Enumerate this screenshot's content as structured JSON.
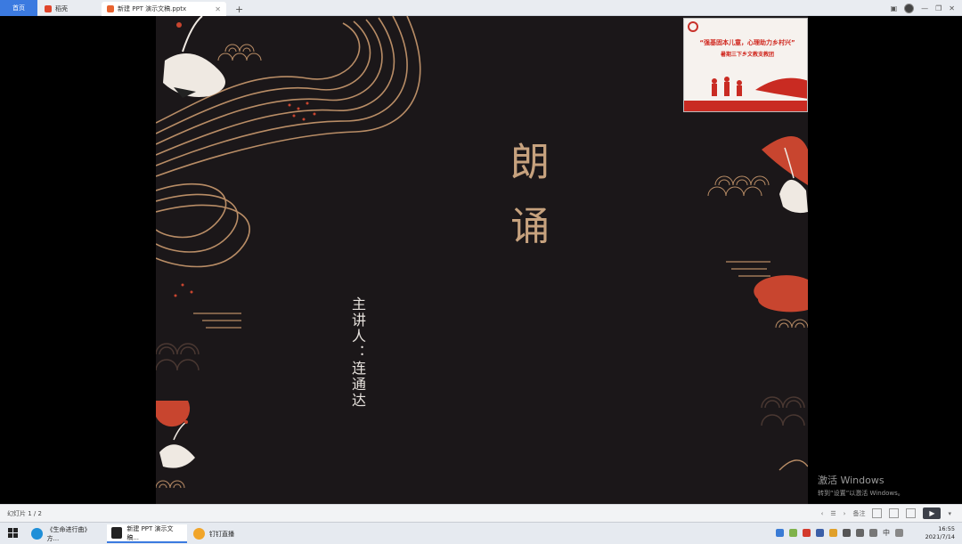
{
  "browser": {
    "tabs": [
      {
        "label": "首页"
      },
      {
        "label": "稻壳"
      },
      {
        "label": "新建 PPT 演示文稿.pptx"
      }
    ]
  },
  "slide": {
    "title_chars": [
      "朗",
      "诵"
    ],
    "speaker": "主讲人：连通达"
  },
  "camera_overlay": {
    "line1": "“强基固本儿童，心理助力乡村兴”",
    "line2": "暑期三下乡文教支教团"
  },
  "watermark": {
    "line1": "激活 Windows",
    "line2": "转到“设置”以激活 Windows。"
  },
  "statusbar": {
    "slide_counter": "幻灯片 1 / 2",
    "notes_label": "备注"
  },
  "taskbar": {
    "items": [
      {
        "label": "《生命进行曲》方..."
      },
      {
        "label": "新建 PPT 演示文稿..."
      },
      {
        "label": "钉钉直播"
      }
    ],
    "ime": "中",
    "time": "16:55",
    "date": "2021/7/14"
  },
  "colors": {
    "slide_bg": "#1b1719",
    "title": "#c7a27e",
    "accent_red": "#c8452f",
    "gold_line": "#b98d66"
  }
}
